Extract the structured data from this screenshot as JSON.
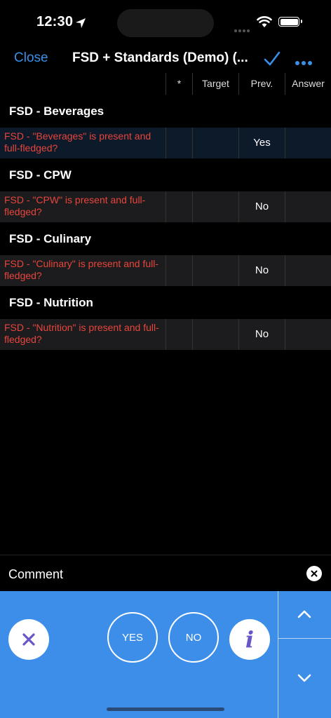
{
  "status": {
    "time": "12:30"
  },
  "nav": {
    "close_label": "Close",
    "title": "FSD + Standards (Demo) (..."
  },
  "table": {
    "columns": [
      "*",
      "Target",
      "Prev.",
      "Answer"
    ]
  },
  "sections": [
    {
      "title": "FSD - Beverages",
      "question": "FSD - \"Beverages\" is present and full-fledged?",
      "star": "",
      "target": "",
      "prev": "Yes",
      "answer": "",
      "selected": true
    },
    {
      "title": "FSD - CPW",
      "question": "FSD - \"CPW\" is present and full-fledged?",
      "star": "",
      "target": "",
      "prev": "No",
      "answer": "",
      "selected": false
    },
    {
      "title": "FSD - Culinary",
      "question": "FSD - \"Culinary\" is present and full-fledged?",
      "star": "",
      "target": "",
      "prev": "No",
      "answer": "",
      "selected": false
    },
    {
      "title": "FSD - Nutrition",
      "question": "FSD - \"Nutrition\" is present and full-fledged?",
      "star": "",
      "target": "",
      "prev": "No",
      "answer": "",
      "selected": false
    }
  ],
  "comment": {
    "label": "Comment"
  },
  "answer_panel": {
    "yes_label": "YES",
    "no_label": "NO",
    "info_label": "i"
  },
  "colors": {
    "accent": "#3a8fe8",
    "panel": "#3d8ee9",
    "question_text": "#e8453c",
    "info_icon": "#6a55c8"
  },
  "icons": {
    "location": "location-arrow-icon",
    "wifi": "wifi-icon",
    "battery": "battery-icon",
    "check": "checkmark-icon",
    "more": "more-dots-icon",
    "clear": "clear-x-icon",
    "cancel": "cancel-x-icon",
    "up": "chevron-up-icon",
    "down": "chevron-down-icon"
  }
}
